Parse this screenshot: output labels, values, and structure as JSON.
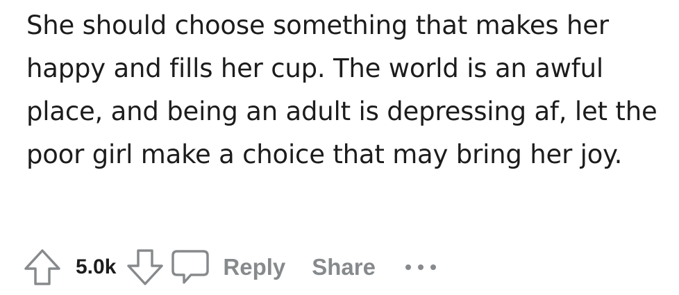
{
  "comment": {
    "text": "She should choose something that makes her happy and fills her cup. The world is an awful place, and being an adult is depressing af, let the poor girl make a choice that may bring her joy."
  },
  "actions": {
    "vote_count": "5.0k",
    "reply_label": "Reply",
    "share_label": "Share",
    "more_label": "•••"
  },
  "icons": {
    "upvote": "arrow-up-outline-icon",
    "downvote": "arrow-down-outline-icon",
    "comment": "speech-bubble-icon",
    "more": "ellipsis-icon"
  },
  "colors": {
    "text": "#1c1c1c",
    "muted": "#878a8c"
  }
}
